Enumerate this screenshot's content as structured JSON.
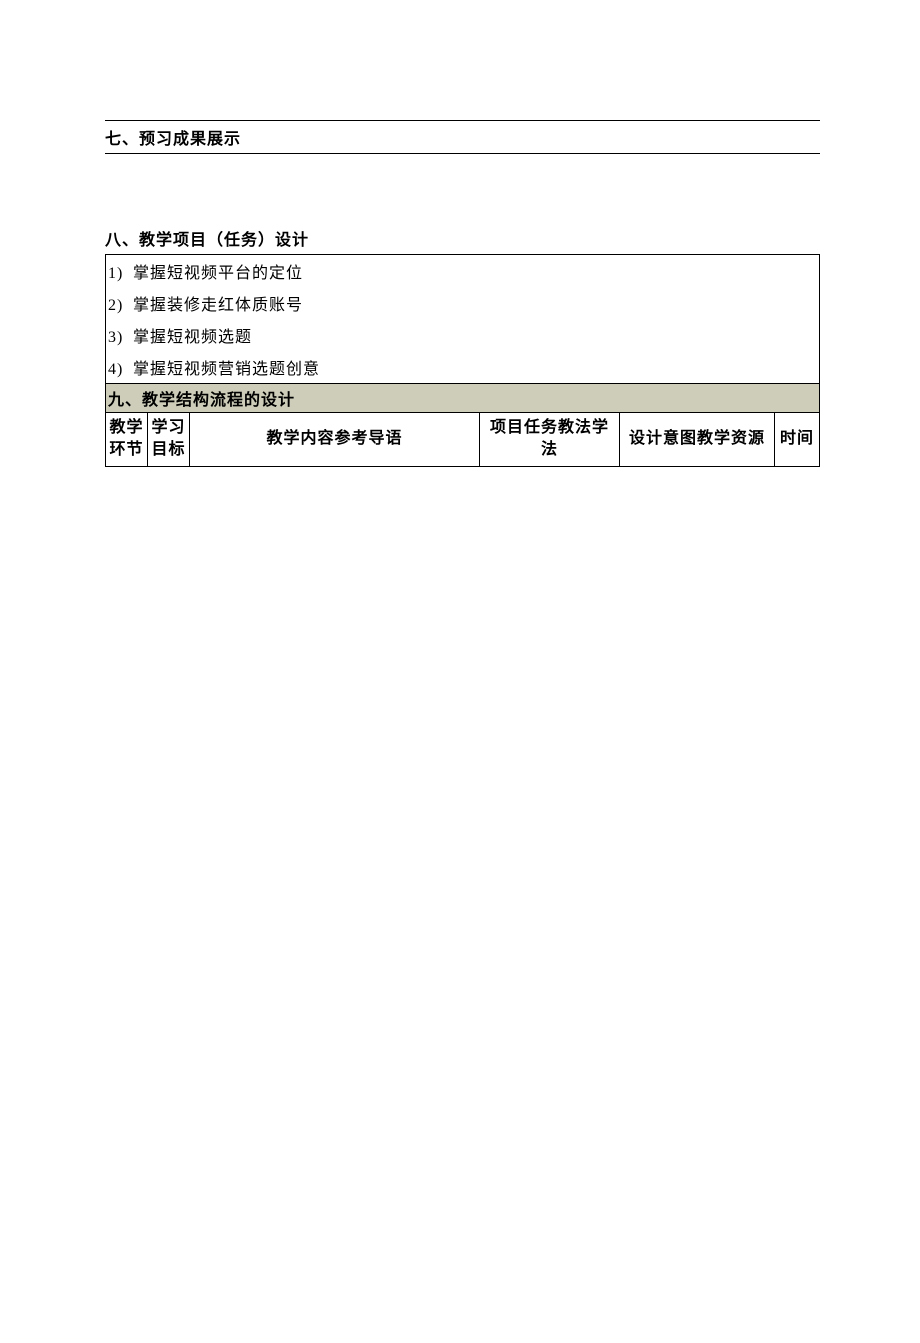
{
  "sections": {
    "seven": {
      "title": "七、预习成果展示"
    },
    "eight": {
      "title": "八、教学项目（任务）设计",
      "items": [
        {
          "num": "1)",
          "text": "掌握短视频平台的定位"
        },
        {
          "num": "2)",
          "text": "掌握装修走红体质账号"
        },
        {
          "num": "3)",
          "text": "掌握短视频选题"
        },
        {
          "num": "4)",
          "text": "掌握短视频营销选题创意"
        }
      ]
    },
    "nine": {
      "title": "九、教学结构流程的设计",
      "headers": {
        "col1": "教学环节",
        "col2": "学习目标",
        "col3": "教学内容参考导语",
        "col4": "项目任务教法学法",
        "col5": "设计意图教学资源",
        "col6": "时间"
      }
    }
  }
}
